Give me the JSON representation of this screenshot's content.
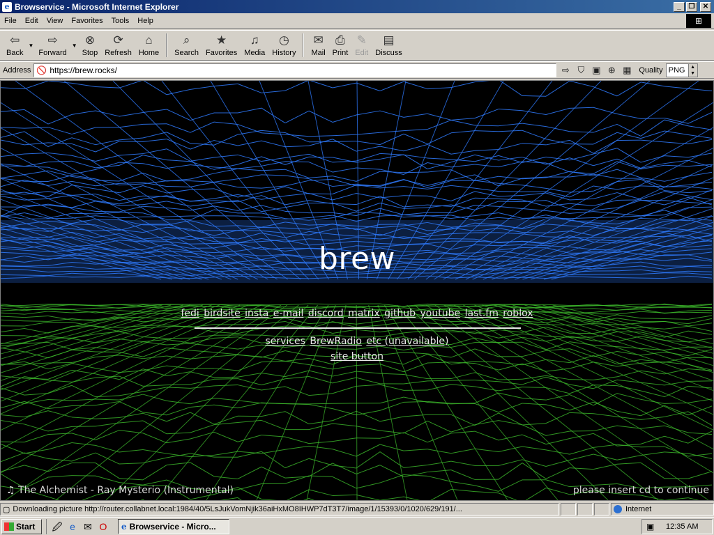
{
  "window": {
    "title": "Browservice - Microsoft Internet Explorer"
  },
  "menu": [
    "File",
    "Edit",
    "View",
    "Favorites",
    "Tools",
    "Help"
  ],
  "toolbar": {
    "back": "Back",
    "forward": "Forward",
    "stop": "Stop",
    "refresh": "Refresh",
    "home": "Home",
    "search": "Search",
    "favorites": "Favorites",
    "media": "Media",
    "history": "History",
    "mail": "Mail",
    "print": "Print",
    "edit": "Edit",
    "discuss": "Discuss"
  },
  "address": {
    "label": "Address",
    "url": "https://brew.rocks/",
    "quality_label": "Quality",
    "quality_value": "PNG"
  },
  "page": {
    "title": "brew",
    "links": [
      "fedi",
      "birdsite",
      "insta",
      "e-mail",
      "discord",
      "matrix",
      "github",
      "youtube",
      "last.fm",
      "roblox"
    ],
    "links2": [
      "services",
      "BrewRadio",
      "etc (unavailable)"
    ],
    "site_button": "site button",
    "now_playing": "The Alchemist - Ray Mysterio (Instrumental)",
    "insert_cd": "please insert cd to continue",
    "colors": {
      "blue_mesh": "#2f7bff",
      "green_mesh": "#3dbb2c"
    }
  },
  "status": {
    "text": "Downloading picture http://router.collabnet.local:1984/40/5LsJukVomNjik36aiHxMO8IHWP7dT3T7/image/1/15393/0/1020/629/191/...",
    "zone": "Internet"
  },
  "taskbar": {
    "start": "Start",
    "task": "Browservice - Micro...",
    "clock": "12:35 AM"
  }
}
